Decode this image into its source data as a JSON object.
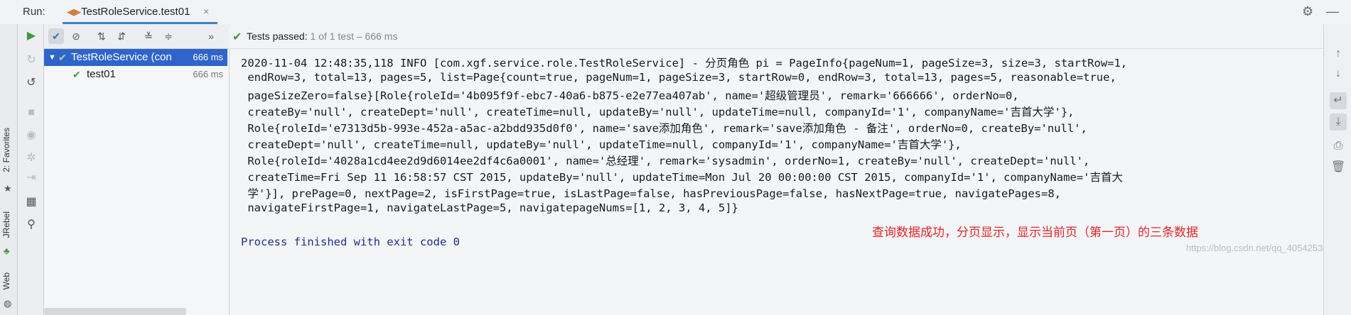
{
  "header": {
    "run_label": "Run:",
    "tab_title": "TestRoleService.test01",
    "tab_close": "×"
  },
  "icons": {
    "tab": "junit-run-icon",
    "settings": "gear-icon",
    "minimize": "minimize-icon",
    "close": "close-icon"
  },
  "side_tabs": {
    "favorites": "2: Favorites",
    "jrebel": "JRebel",
    "web": "Web"
  },
  "status": {
    "prefix": "Tests passed:",
    "detail": "1 of 1 test – 666 ms"
  },
  "tree": {
    "root": {
      "name": "TestRoleService (con",
      "time": "666 ms"
    },
    "child": {
      "name": "test01",
      "time": "666 ms"
    }
  },
  "console": {
    "cut_line": "   ·······································································",
    "lines": [
      "2020-11-04 12:48:35,118 INFO [com.xgf.service.role.TestRoleService] - 分页角色 pi = PageInfo{pageNum=1, pageSize=3, size=3, startRow=1,",
      " endRow=3, total=13, pages=5, list=Page{count=true, pageNum=1, pageSize=3, startRow=0, endRow=3, total=13, pages=5, reasonable=true,",
      " pageSizeZero=false}[Role{roleId='4b095f9f-ebc7-40a6-b875-e2e77ea407ab', name='超级管理员', remark='666666', orderNo=0,",
      " createBy='null', createDept='null', createTime=null, updateBy='null', updateTime=null, companyId='1', companyName='吉首大学'},",
      " Role{roleId='e7313d5b-993e-452a-a5ac-a2bdd935d0f0', name='save添加角色', remark='save添加角色 - 备注', orderNo=0, createBy='null',",
      " createDept='null', createTime=null, updateBy='null', updateTime=null, companyId='1', companyName='吉首大学'},",
      " Role{roleId='4028a1cd4ee2d9d6014ee2df4c6a0001', name='总经理', remark='sysadmin', orderNo=1, createBy='null', createDept='null',",
      " createTime=Fri Sep 11 16:58:57 CST 2015, updateBy='null', updateTime=Mon Jul 20 00:00:00 CST 2015, companyId='1', companyName='吉首大",
      " 学'}], prePage=0, nextPage=2, isFirstPage=true, isLastPage=false, hasPreviousPage=false, hasNextPage=true, navigatePages=8,",
      " navigateFirstPage=1, navigateLastPage=5, navigatepageNums=[1, 2, 3, 4, 5]}"
    ],
    "process": "Process finished with exit code 0",
    "annotation": "查询数据成功，分页显示，显示当前页（第一页）的三条数据",
    "watermark": "https://blog.csdn.net/qq_40542534"
  }
}
